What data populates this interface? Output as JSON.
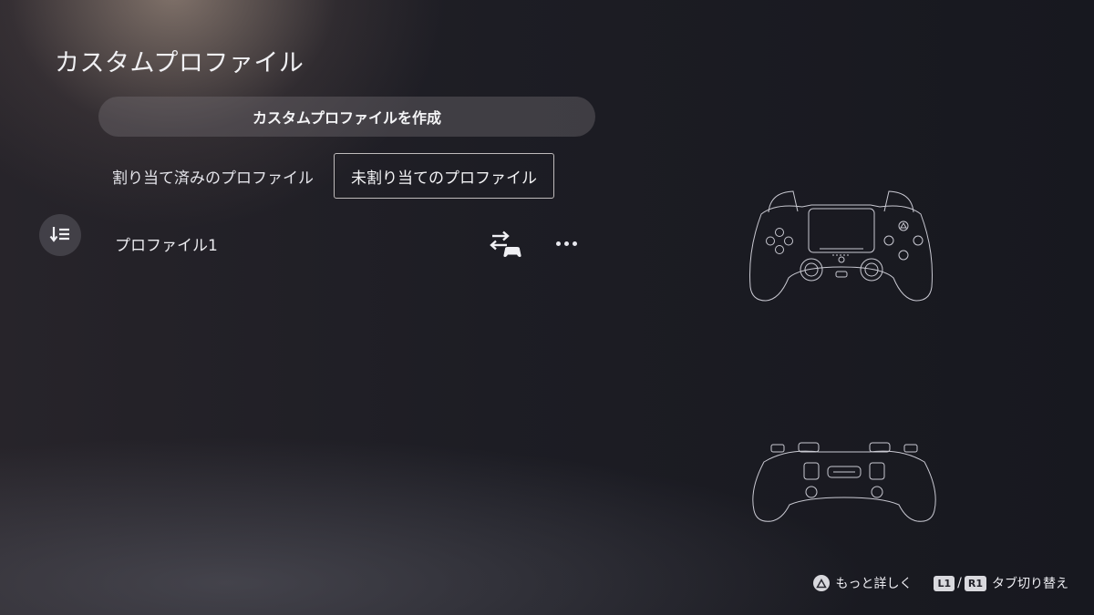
{
  "page": {
    "title": "カスタムプロファイル"
  },
  "create_button": {
    "label": "カスタムプロファイルを作成"
  },
  "tabs": [
    {
      "label": "割り当て済みのプロファイル",
      "selected": false
    },
    {
      "label": "未割り当てのプロファイル",
      "selected": true
    }
  ],
  "profiles": [
    {
      "name": "プロファイル1"
    }
  ],
  "footer": {
    "more_label": "もっと詳しく",
    "l1": "L1",
    "slash": "/",
    "r1": "R1",
    "switch_label": "タブ切り替え"
  },
  "icons": {
    "sort": "sort-icon",
    "swap": "assign-controller-icon",
    "more": "more-options-icon",
    "triangle": "triangle-button-icon"
  }
}
